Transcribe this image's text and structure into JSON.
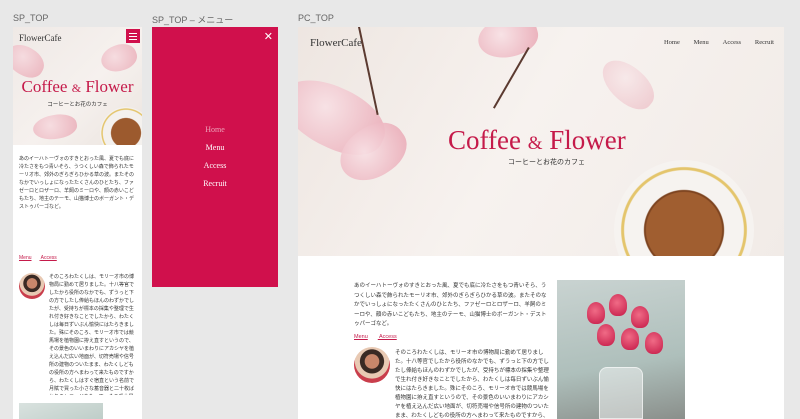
{
  "labels": {
    "sp": "SP_TOP",
    "menu": "SP_TOP – メニュー",
    "pc": "PC_TOP"
  },
  "site": {
    "logo": "FlowerCafe",
    "title_main": "Coffee",
    "title_amp": "&",
    "title_end": "Flower",
    "subtitle": "コーヒーとお花のカフェ"
  },
  "nav": {
    "items": [
      "Home",
      "Menu",
      "Access",
      "Recruit"
    ]
  },
  "content": {
    "intro": "あのイーハトーヴォのすきとおった風、夏でも底に冷たさをもつ青いそら、うつくしい森で飾られたモーリオ市、郊外のぎらぎらひかる草の波。またそのなかでいっしょになったたくさんのひとたち、ファゼーロとロザーロ、羊飼のミーロや、顔の赤いこどもたち、地主のテーモ、山猫博士のボーガント・デストゥパーゴなど。",
    "profile": "そのころわたくしは、モリーオ市の博物局に勤めて居りました。十八等官でしたから役所のなかでも、ずうっと下の方でしたし俸給もほんのわずかでしたが、受持ちが標本の採集や整理で生れ付き好きなことでしたから、わたくしは毎日ずいぶん愉快にはたらきました。殊にそのころ、モリーオ市では競馬場を植物園に拵え直すというので、その景色のいいまわりにアカシヤを植え込んだ広い地面が、切符売場や信号所の建物のついたまま、わたくしどもの役所の方へまわって来たものですから、わたくしはすぐ宿直という名前で月賦で買った小さな蓄音器と二十枚ばかりのレコードをもって、その番小屋にひとり住むことになりました。",
    "links": [
      "Menu",
      "Access"
    ]
  },
  "menu": {
    "close_icon": "close-icon",
    "active": "Home"
  },
  "colors": {
    "accent": "#d0104c",
    "title": "#c51a4a"
  }
}
